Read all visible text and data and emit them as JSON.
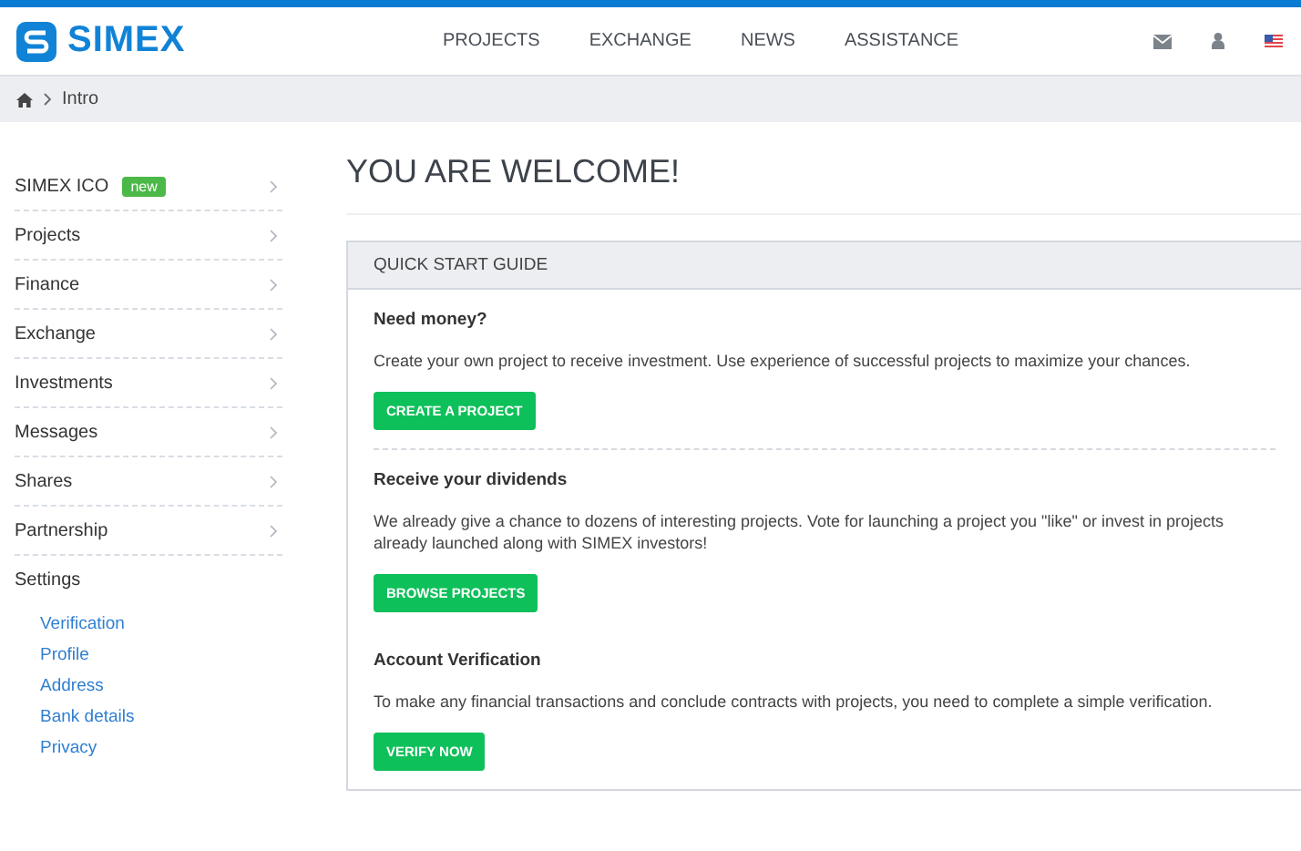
{
  "header": {
    "logo": "SIMEX",
    "nav": [
      {
        "label": "PROJECTS"
      },
      {
        "label": "EXCHANGE"
      },
      {
        "label": "NEWS"
      },
      {
        "label": "ASSISTANCE"
      }
    ]
  },
  "breadcrumb": {
    "current": "Intro"
  },
  "sidebar": {
    "items": [
      {
        "label": "SIMEX ICO",
        "badge": "new"
      },
      {
        "label": "Projects"
      },
      {
        "label": "Finance"
      },
      {
        "label": "Exchange"
      },
      {
        "label": "Investments"
      },
      {
        "label": "Messages"
      },
      {
        "label": "Shares"
      },
      {
        "label": "Partnership"
      },
      {
        "label": "Settings",
        "children": [
          {
            "label": "Verification"
          },
          {
            "label": "Profile"
          },
          {
            "label": "Address"
          },
          {
            "label": "Bank details"
          },
          {
            "label": "Privacy"
          }
        ]
      }
    ]
  },
  "page_title": "YOU ARE WELCOME!",
  "guide": {
    "title": "QUICK START GUIDE",
    "sections": [
      {
        "heading": "Need money?",
        "text": "Create your own project to receive investment. Use experience of successful projects to maximize your chances.",
        "button": "CREATE A PROJECT"
      },
      {
        "heading": "Receive your dividends",
        "text": "We already give a chance to dozens of interesting projects. Vote for launching a project you \"like\" or invest in projects already launched along with SIMEX investors!",
        "button": "BROWSE PROJECTS"
      },
      {
        "heading": "Account Verification",
        "text": "To make any financial transactions and conclude contracts with projects, you need to complete a simple verification.",
        "button": "VERIFY NOW"
      }
    ]
  }
}
